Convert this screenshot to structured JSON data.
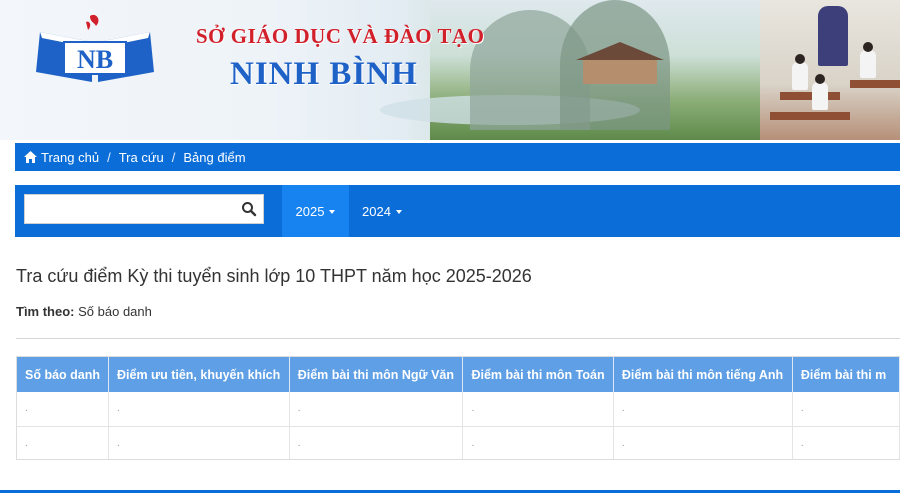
{
  "header": {
    "org_title": "SỞ GIÁO DỤC VÀ ĐÀO TẠO",
    "org_name": "NINH BÌNH",
    "logo_text": "NB"
  },
  "breadcrumb": {
    "items": [
      "Trang chủ",
      "Tra cứu",
      "Bảng điểm"
    ],
    "separator": "/"
  },
  "search": {
    "value": "",
    "placeholder": "",
    "icon": "search-icon"
  },
  "year_tabs": [
    {
      "label": "2025",
      "active": true
    },
    {
      "label": "2024",
      "active": false
    }
  ],
  "page": {
    "title": "Tra cứu điểm Kỳ thi tuyển sinh lớp 10 THPT năm học 2025-2026",
    "search_by_label": "Tìm theo:",
    "search_by_value": "Số báo danh"
  },
  "table": {
    "columns": [
      "Số báo danh",
      "Điểm ưu tiên, khuyến khích",
      "Điểm bài thi môn Ngữ Văn",
      "Điểm bài thi môn Toán",
      "Điểm bài thi môn tiếng Anh",
      "Điểm bài thi m"
    ],
    "rows": [
      [
        ".",
        ".",
        ".",
        ".",
        ".",
        "."
      ],
      [
        ".",
        ".",
        ".",
        ".",
        ".",
        "."
      ]
    ]
  },
  "colors": {
    "nav_blue": "#0b6ed8",
    "active_tab": "#1683f0",
    "table_header": "#5e9fe6",
    "title_red": "#d2202b",
    "title_blue": "#1f62c7"
  }
}
